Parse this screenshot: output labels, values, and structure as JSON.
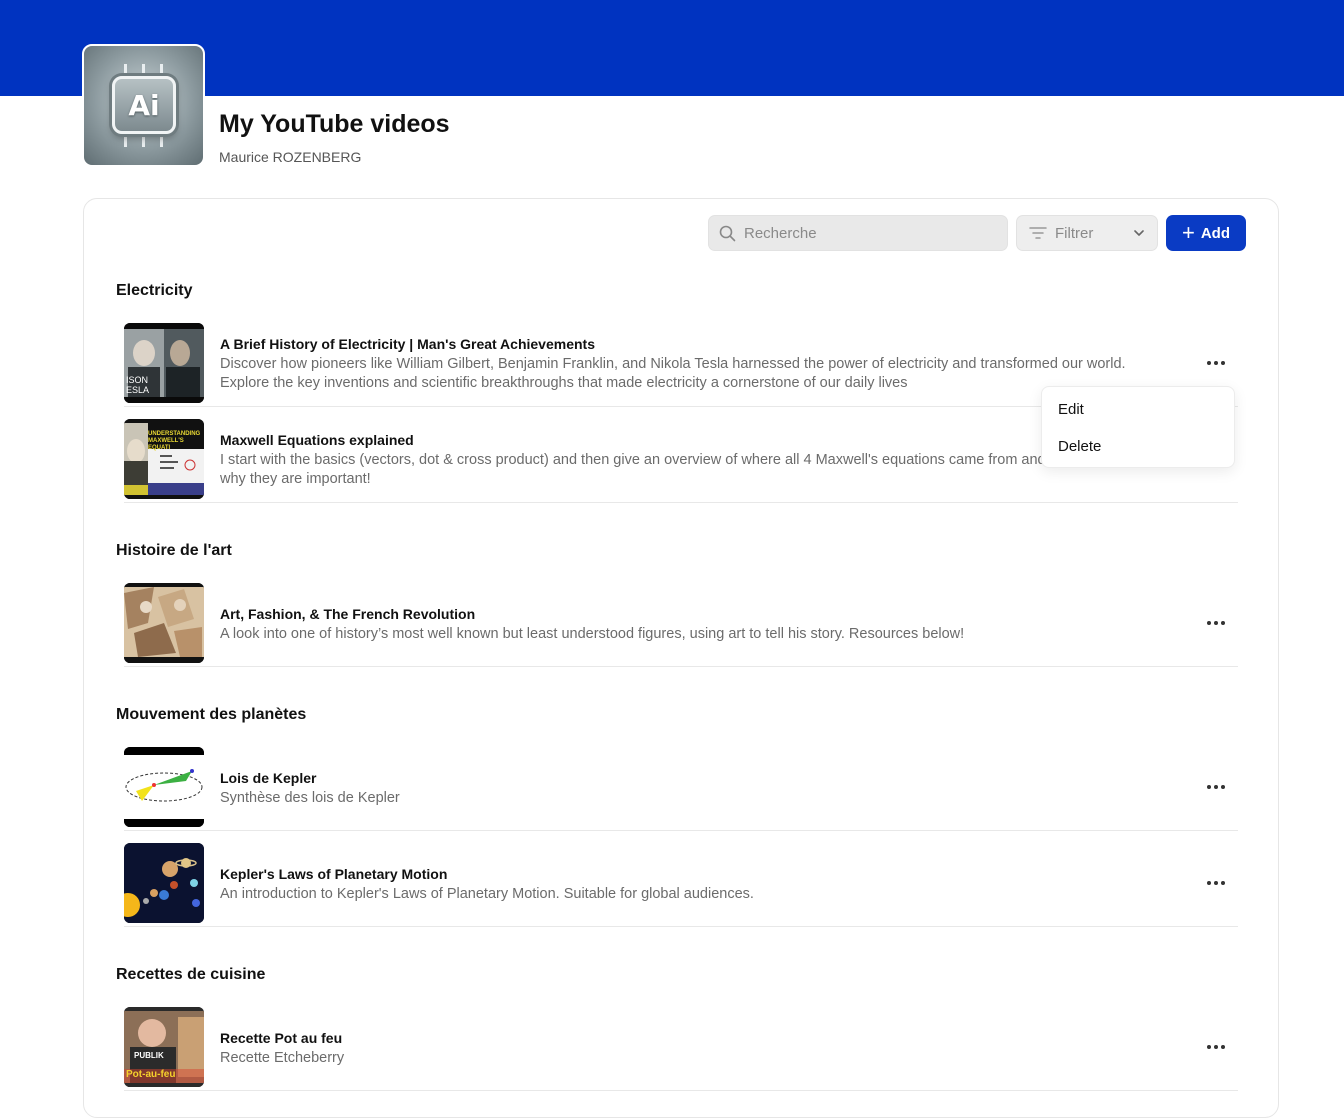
{
  "header": {
    "title": "My YouTube videos",
    "author": "Maurice ROZENBERG",
    "logo_text": "Ai",
    "banner_color": "#0033c0"
  },
  "toolbar": {
    "search_placeholder": "Recherche",
    "filter_label": "Filtrer",
    "add_label": "Add",
    "accent_color": "#0a3bc4"
  },
  "sections": [
    {
      "title": "Electricity",
      "videos": [
        {
          "title": "A Brief History of Electricity | Man's Great Achievements",
          "description": "Discover how pioneers like William Gilbert, Benjamin Franklin, and Nikola Tesla harnessed the power of electricity and transformed our world. Explore the key inventions and scientific breakthroughs that made electricity a cornerstone of our daily lives"
        },
        {
          "title": "Maxwell Equations explained",
          "description": "I start with the basics (vectors, dot & cross product) and then give an overview of where all 4 Maxwell's equations came from and why they are important!"
        }
      ]
    },
    {
      "title": "Histoire de l'art",
      "videos": [
        {
          "title": "Art, Fashion, & The French Revolution",
          "description": "A look into one of history’s most well known but least understood figures, using art to tell his story. Resources below!"
        }
      ]
    },
    {
      "title": "Mouvement des planètes",
      "videos": [
        {
          "title": "Lois de Kepler",
          "description": "Synthèse des lois de Kepler"
        },
        {
          "title": "Kepler's Laws of Planetary Motion",
          "description": "An introduction to Kepler's Laws of Planetary Motion. Suitable for global audiences."
        }
      ]
    },
    {
      "title": "Recettes de cuisine",
      "videos": [
        {
          "title": "Recette Pot au feu",
          "description": "Recette Etcheberry"
        }
      ]
    }
  ],
  "thumbnail_text": {
    "tesla": "ISON ESLA",
    "maxwell": "UNDERSTANDING MAXWELL'S EQUATI",
    "potaufeu": "Pot-au-feu",
    "publik": "PUBLIK"
  },
  "context_menu": {
    "items": [
      "Edit",
      "Delete"
    ]
  }
}
